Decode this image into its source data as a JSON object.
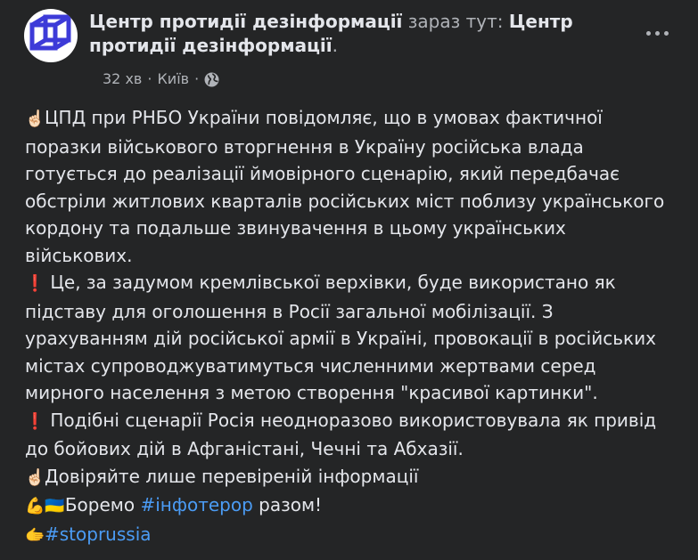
{
  "header": {
    "page_name": "Центр протидії дезінформації",
    "connector": " зараз тут: ",
    "location_page_name_line1": "Центр",
    "location_page_name_line2": "протидії дезінформації",
    "trailing": ".",
    "time": "32 хв",
    "city": "Київ",
    "audience_icon": "globe-icon",
    "more_icon": "more-horizontal-icon"
  },
  "post": {
    "lines": [
      {
        "emoji": "☝🏻",
        "text": "ЦПД при РНБО України повідомляє, що в умовах фактичної"
      },
      {
        "text": "поразки військового вторгнення в Україну російська влада"
      },
      {
        "text": "готується до реалізації ймовірного сценарію, який передбачає"
      },
      {
        "text": "обстріли житлових кварталів російських міст поблизу українського"
      },
      {
        "text": "кордону та подальше звинувачення в цьому українських"
      },
      {
        "text": "військових."
      },
      {
        "emoji": "❗",
        "text": " Це, за задумом кремлівської верхівки, буде використано як"
      },
      {
        "text": "підставу для оголошення в Росії загальної мобілізації. З"
      },
      {
        "text": "урахуванням дій російської армії в Україні, провокації в російських"
      },
      {
        "text": "містах супроводжуватимуться численними жертвами серед"
      },
      {
        "text": "мирного населення з метою створення \"красивої картинки\"."
      },
      {
        "emoji": "❗",
        "text": " Подібні сценарії Росія неодноразово використовувала як привід"
      },
      {
        "text": "до бойових дій в Афганістані, Чечні та Абхазії."
      },
      {
        "emoji": "☝🏻",
        "text": "Довіряйте лише перевіреній інформації"
      }
    ],
    "fight_emoji": "💪🇺🇦",
    "fight_pre": "Боремо ",
    "fight_tag": "#інфотерор",
    "fight_post": " разом!",
    "pointing_emoji": "🫱",
    "stop_tag": "#stoprussia"
  },
  "colors": {
    "background": "#242526",
    "text": "#e4e6eb",
    "muted": "#b0b3b8",
    "hashtag": "#4b9cf5",
    "avatar_blue": "#3d3bd8"
  }
}
